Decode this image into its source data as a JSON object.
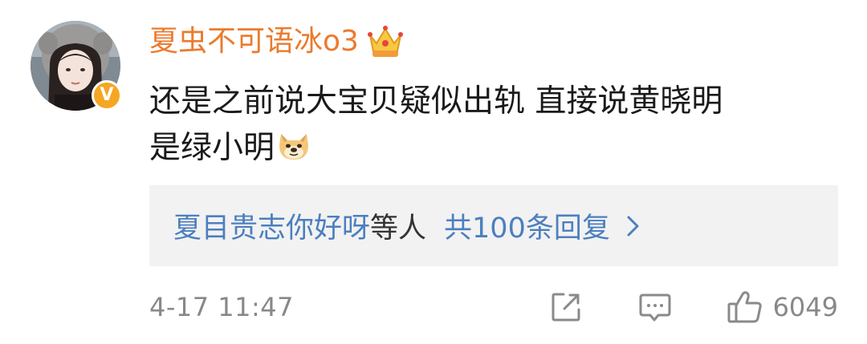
{
  "comment": {
    "author": {
      "username": "夏虫不可语冰o3",
      "verified_icon": "verified-v-badge-icon",
      "vip_icon": "crown-vip-icon",
      "username_color": "#ec7a2d",
      "verified_color": "#f5a623"
    },
    "text_lines": [
      "还是之前说大宝贝疑似出轨 直接说黄晓明",
      "是绿小明"
    ],
    "emoji": "doge-emoji-icon",
    "replies": {
      "names": "夏目贵志你好呀",
      "suffix": "等人",
      "count_label": "共100条回复",
      "chevron_icon": "chevron-right-icon",
      "link_color": "#4c7fbf"
    },
    "timestamp": "4-17 11:47",
    "actions": {
      "share_icon": "share-icon",
      "comment_icon": "comment-icon",
      "like_icon": "thumbs-up-icon",
      "like_count": "6049"
    }
  }
}
